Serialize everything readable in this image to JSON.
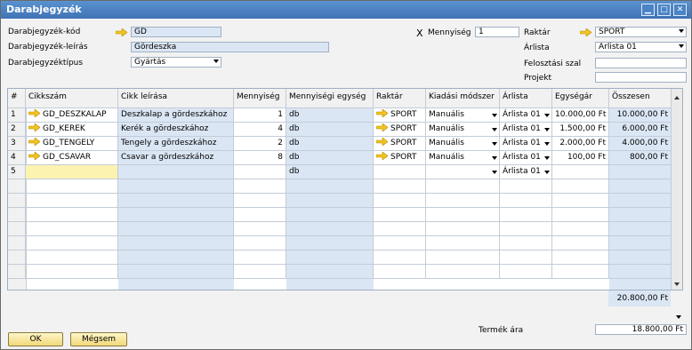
{
  "window": {
    "title": "Darabjegyzék"
  },
  "header": {
    "code_label": "Darabjegyzék-kód",
    "code_value": "GD",
    "desc_label": "Darabjegyzék-leírás",
    "desc_value": "Gördeszka",
    "type_label": "Darabjegyzéktípus",
    "type_value": "Gyártás",
    "qty_prefix": "X",
    "qty_label": "Mennyiség",
    "qty_value": "1",
    "warehouse_label": "Raktár",
    "warehouse_value": "SPORT",
    "pricelist_label": "Árlista",
    "pricelist_value": "Árlista 01",
    "distribution_label": "Felosztási szal",
    "distribution_value": "",
    "project_label": "Projekt",
    "project_value": ""
  },
  "table": {
    "columns": [
      "#",
      "Cikkszám",
      "Cikk leírása",
      "Mennyiség",
      "Mennyiségi egység",
      "Raktár",
      "Kiadási módszer",
      "Árlista",
      "Egységár",
      "Összesen"
    ],
    "rows": [
      {
        "num": "1",
        "item": "GD_DESZKALAP",
        "desc": "Deszkalap a gördeszkához",
        "qty": "1",
        "uom": "db",
        "wh": "SPORT",
        "method": "Manuális",
        "pl": "Árlista 01",
        "price": "10.000,00 Ft",
        "total": "10.000,00 Ft"
      },
      {
        "num": "2",
        "item": "GD_KEREK",
        "desc": "Kerék a gördeszkához",
        "qty": "4",
        "uom": "db",
        "wh": "SPORT",
        "method": "Manuális",
        "pl": "Árlista 01",
        "price": "1.500,00 Ft",
        "total": "6.000,00 Ft"
      },
      {
        "num": "3",
        "item": "GD_TENGELY",
        "desc": "Tengely a gördeszkához",
        "qty": "2",
        "uom": "db",
        "wh": "SPORT",
        "method": "Manuális",
        "pl": "Árlista 01",
        "price": "2.000,00 Ft",
        "total": "4.000,00 Ft"
      },
      {
        "num": "4",
        "item": "GD_CSAVAR",
        "desc": "Csavar a gördeszkához",
        "qty": "8",
        "uom": "db",
        "wh": "SPORT",
        "method": "Manuális",
        "pl": "Árlista 01",
        "price": "100,00 Ft",
        "total": "800,00 Ft"
      },
      {
        "num": "5",
        "item": "",
        "desc": "",
        "qty": "",
        "uom": "db",
        "wh": "",
        "method": "",
        "pl": "Árlista 01",
        "price": "",
        "total": ""
      }
    ],
    "grand_total": "20.800,00 Ft"
  },
  "footer": {
    "product_price_label": "Termék ára",
    "product_price_value": "18.800,00 Ft",
    "ok_label": "OK",
    "cancel_label": "Mégsem"
  },
  "colors": {
    "titlebar": "#4a80c2",
    "field_blue": "#dbe6f4",
    "highlight": "#fdf3b0",
    "button": "#f1d87a",
    "arrow": "#f2c41f"
  }
}
